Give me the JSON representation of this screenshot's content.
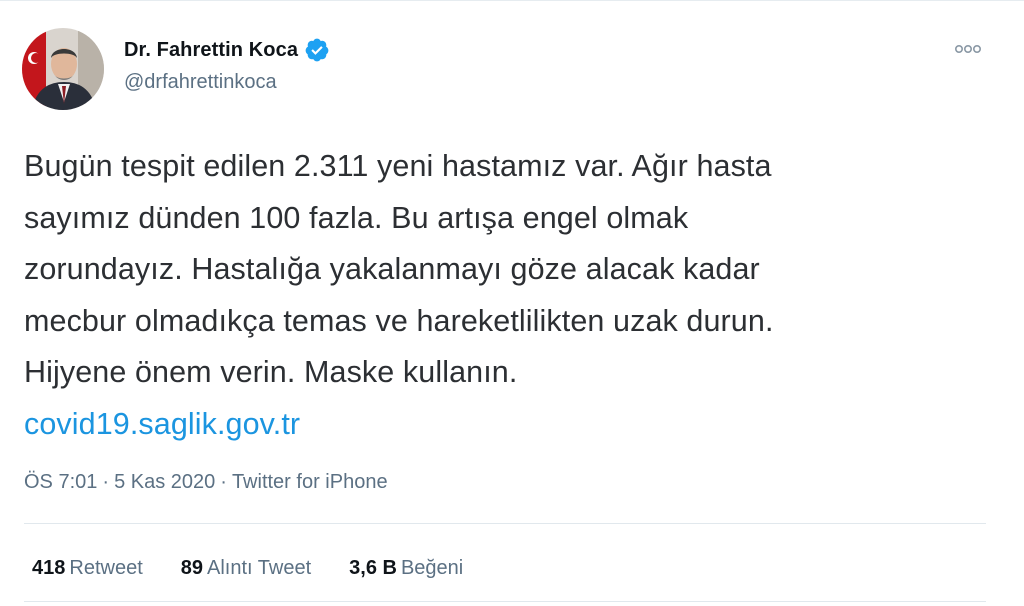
{
  "author": {
    "display_name": "Dr. Fahrettin Koca",
    "handle": "@drfahrettinkoca",
    "verified": true
  },
  "icons": {
    "verified": "verified-badge-icon",
    "more": "more-options-icon",
    "avatar": "profile-avatar"
  },
  "tweet": {
    "lines": [
      "Bugün tespit edilen 2.311 yeni hastamız var. Ağır hasta",
      "sayımız dünden 100 fazla. Bu artışa engel olmak",
      "zorundayız. Hastalığa yakalanmayı göze alacak kadar",
      "mecbur olmadıkça temas ve hareketlilikten uzak durun.",
      "Hijyene önem verin. Maske kullanın."
    ],
    "link": "covid19.saglik.gov.tr"
  },
  "meta": {
    "time": "ÖS 7:01",
    "separator": "·",
    "date": "5 Kas 2020",
    "source": "Twitter for iPhone"
  },
  "stats": {
    "retweets": {
      "count": "418",
      "label": "Retweet"
    },
    "quotes": {
      "count": "89",
      "label": "Alıntı Tweet"
    },
    "likes": {
      "count": "3,6 B",
      "label": "Beğeni"
    }
  },
  "colors": {
    "accent": "#1b95e0",
    "verified": "#1da1f2",
    "secondary_text": "#5b7083",
    "primary_text": "#0f1419",
    "divider": "#e1e8ed"
  }
}
